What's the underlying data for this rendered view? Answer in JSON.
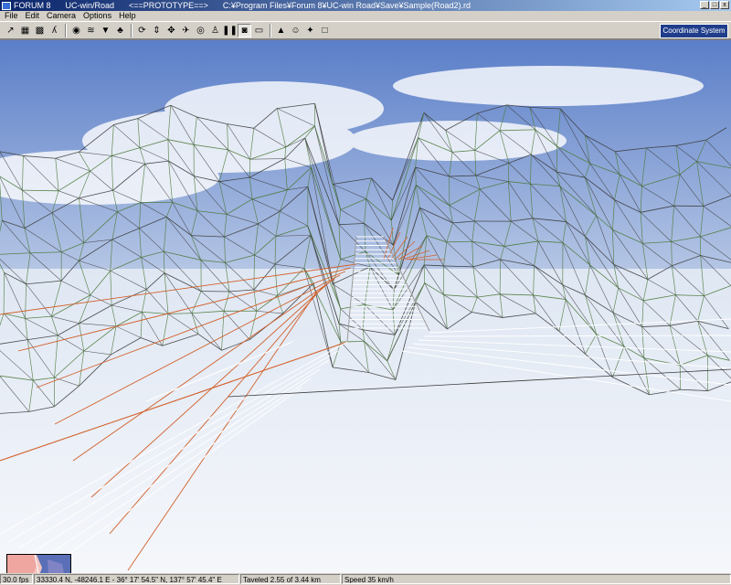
{
  "window": {
    "title_parts": [
      "FORUM 8",
      "UC-win/Road",
      "<==PROTOTYPE==>",
      "C:¥Program Files¥Forum 8¥UC-win Road¥Save¥Sample(Road2).rd"
    ],
    "controls": [
      "_",
      "□",
      "x"
    ]
  },
  "menu": {
    "items": [
      "File",
      "Edit",
      "Camera",
      "Options",
      "Help"
    ]
  },
  "toolbar": {
    "coordinate_system": "Coordinate System 0",
    "buttons": [
      {
        "name": "road-edit-icon",
        "glyph": "↗"
      },
      {
        "name": "plan-view-icon",
        "glyph": "▦"
      },
      {
        "name": "terrain-grid-icon",
        "glyph": "▩"
      },
      {
        "name": "pen-icon",
        "glyph": "ʎ"
      },
      {
        "name": "sep"
      },
      {
        "name": "globe-icon",
        "glyph": "◉"
      },
      {
        "name": "water-icon",
        "glyph": "≋"
      },
      {
        "name": "sign-icon",
        "glyph": "▼"
      },
      {
        "name": "tree-icon",
        "glyph": "♣"
      },
      {
        "name": "sep"
      },
      {
        "name": "rotate-icon",
        "glyph": "⟳"
      },
      {
        "name": "hand-up-icon",
        "glyph": "⇕"
      },
      {
        "name": "move-icon",
        "glyph": "✥"
      },
      {
        "name": "fly-icon",
        "glyph": "✈"
      },
      {
        "name": "camera-icon",
        "glyph": "◎"
      },
      {
        "name": "walk-icon",
        "glyph": "♙"
      },
      {
        "name": "pause-icon",
        "glyph": "❚❚"
      },
      {
        "name": "car-icon",
        "glyph": "◙",
        "pressed": true
      },
      {
        "name": "bus-icon",
        "glyph": "▭"
      },
      {
        "name": "sep"
      },
      {
        "name": "landscape-icon",
        "glyph": "▲"
      },
      {
        "name": "person-icon",
        "glyph": "☺"
      },
      {
        "name": "run-icon",
        "glyph": "✦"
      },
      {
        "name": "disabled-icon",
        "glyph": "□"
      }
    ]
  },
  "status": {
    "fps": "30.0 fps",
    "position": "33330.4 N, -48246.1 E  -  36° 17' 54.5\" N, 137° 57' 45.4\" E",
    "traveled": "Taveled 2.55 of 3.44 km",
    "speed": "Speed 35 km/h"
  },
  "colors": {
    "road_edge": "#d2602a",
    "terrain_green": "#4c7a3a",
    "terrain_dark": "#3a3a3a",
    "sky": "#6f8fcf"
  }
}
